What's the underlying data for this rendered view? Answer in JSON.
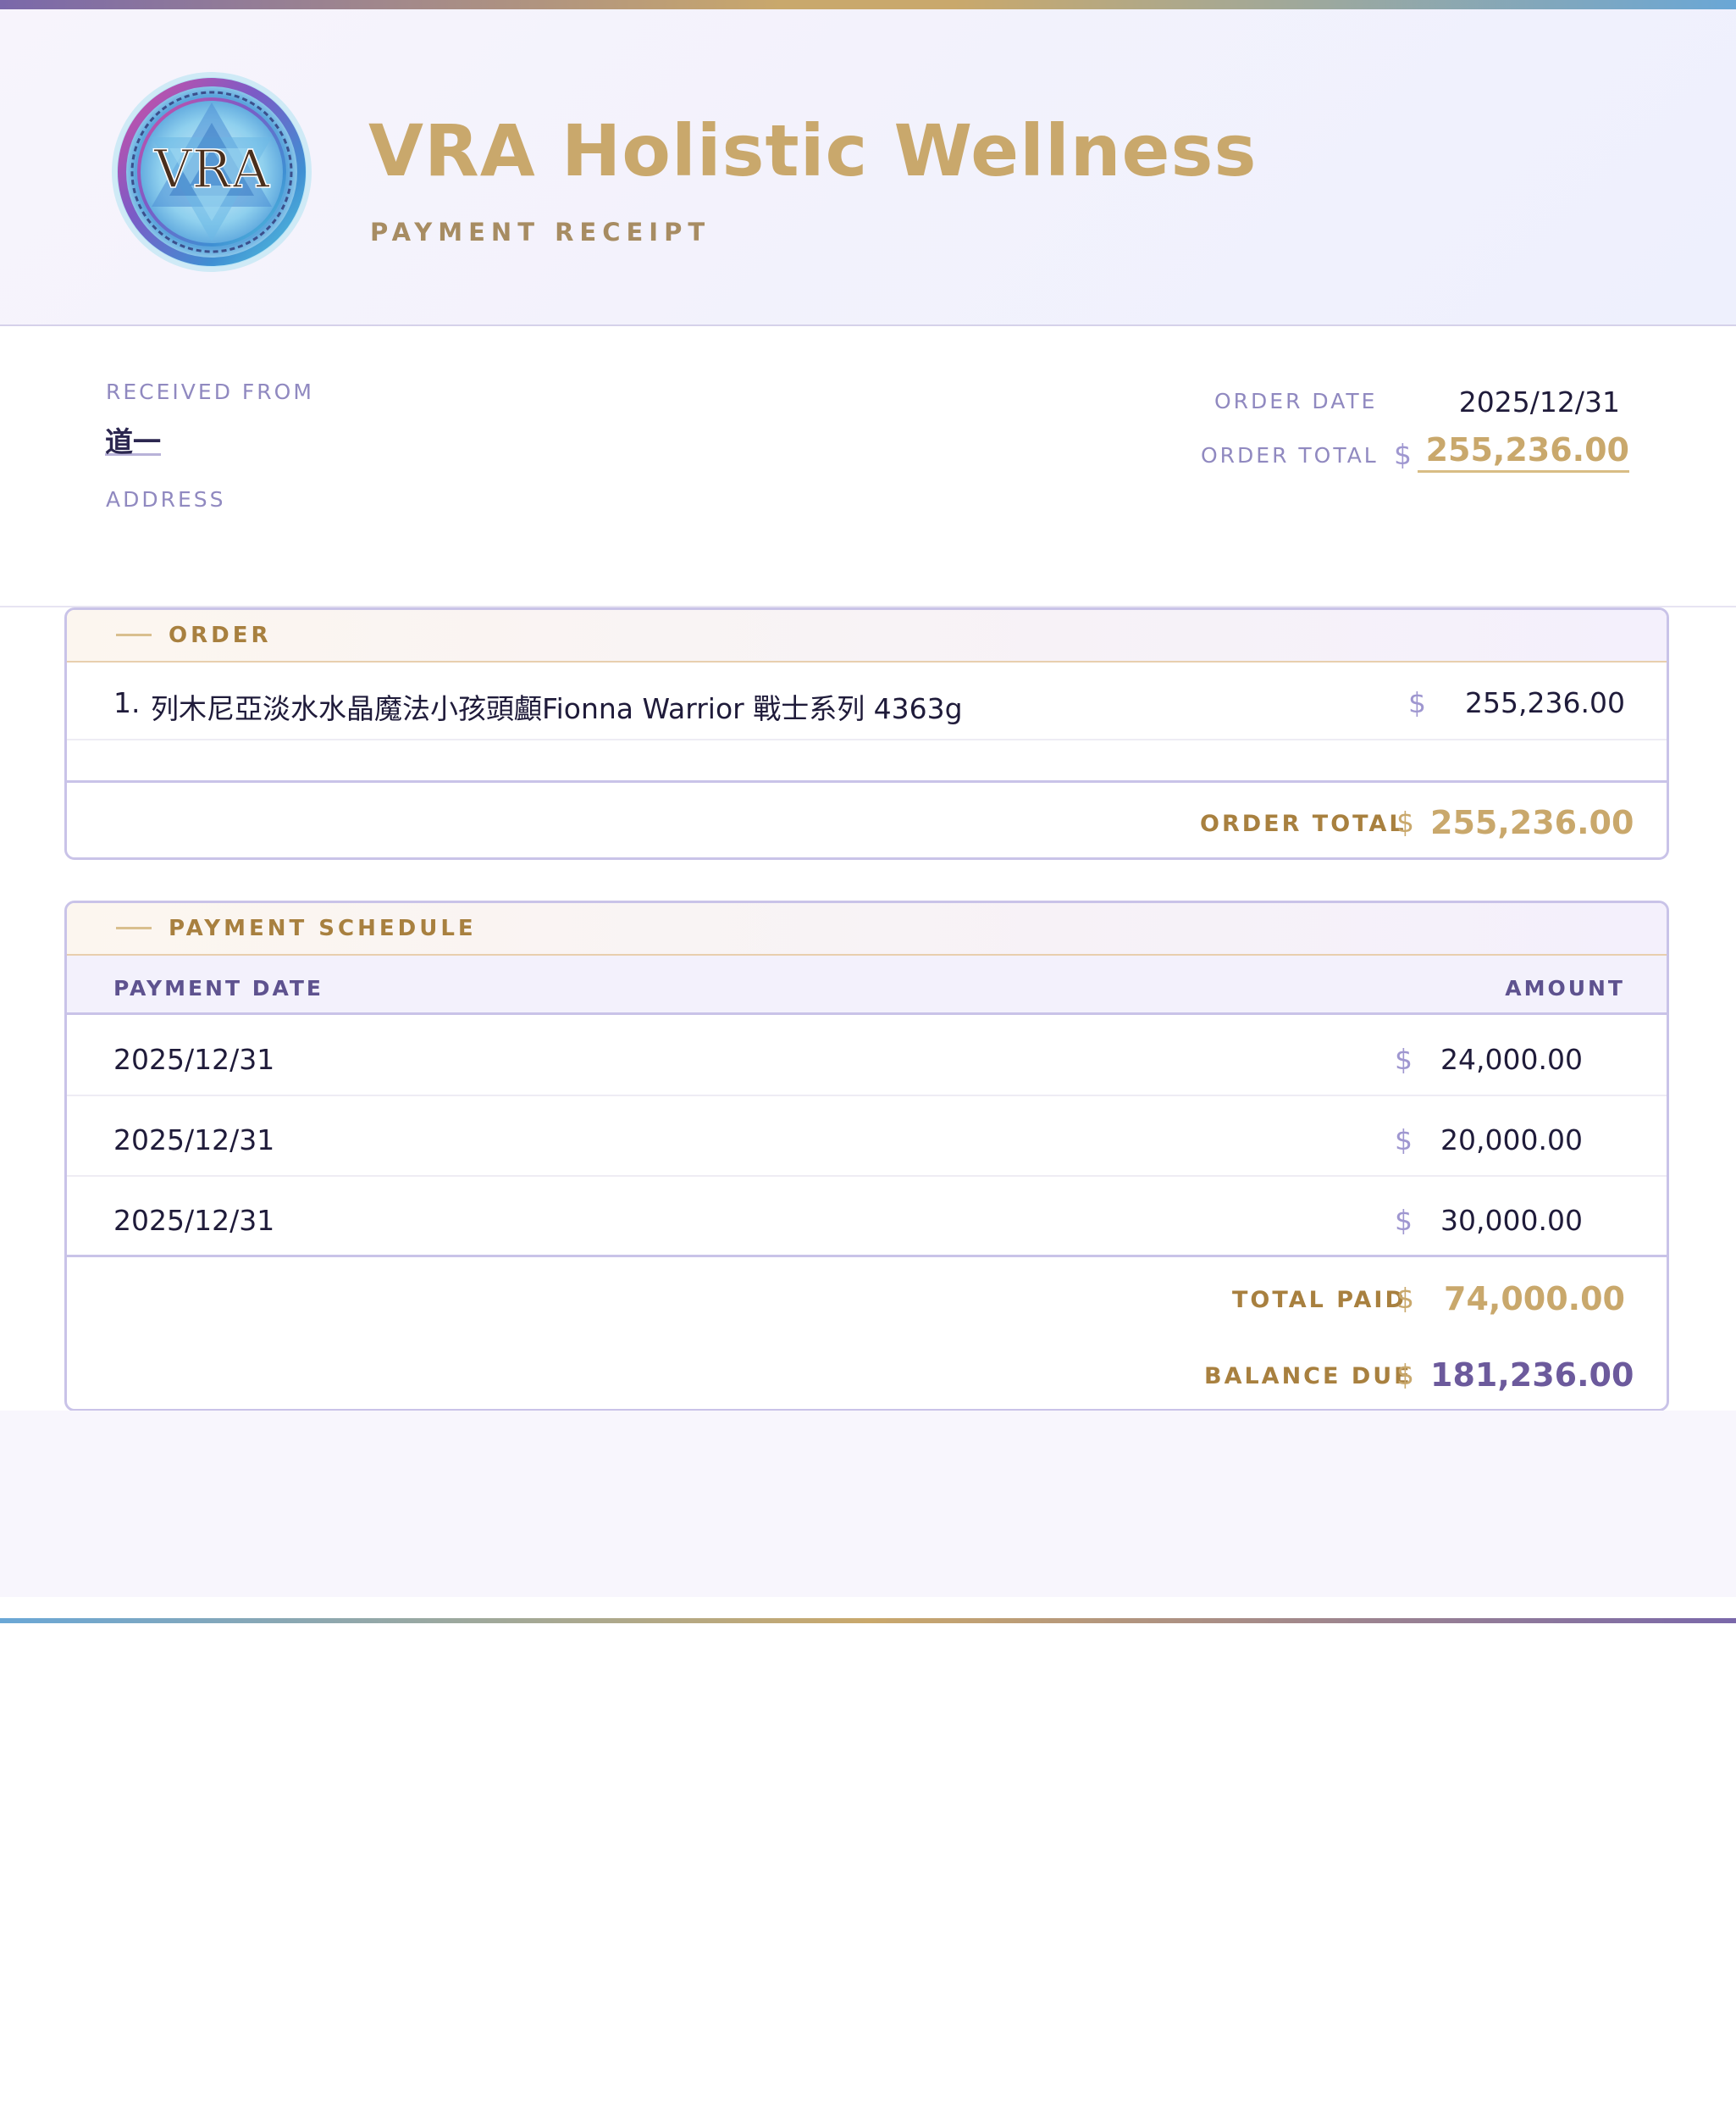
{
  "header": {
    "logo_text": "VRA",
    "brand": "VRA Holistic Wellness",
    "subtitle": "PAYMENT RECEIPT"
  },
  "info": {
    "received_from_label": "RECEIVED FROM",
    "received_from": "道一",
    "address_label": "ADDRESS",
    "order_date_label": "ORDER DATE",
    "order_date": "2025/12/31",
    "order_total_label": "ORDER TOTAL",
    "currency": "$",
    "order_total": "255,236.00"
  },
  "order": {
    "title": "ORDER",
    "items": [
      {
        "index": "1.",
        "description": "列木尼亞淡水水晶魔法小孩頭顱Fionna Warrior 戰士系列 4363g",
        "amount": "255,236.00"
      }
    ],
    "total_label": "ORDER TOTAL",
    "total": "255,236.00"
  },
  "schedule": {
    "title": "PAYMENT SCHEDULE",
    "date_header": "PAYMENT DATE",
    "amount_header": "AMOUNT",
    "payments": [
      {
        "date": "2025/12/31",
        "amount": "24,000.00"
      },
      {
        "date": "2025/12/31",
        "amount": "20,000.00"
      },
      {
        "date": "2025/12/31",
        "amount": "30,000.00"
      }
    ],
    "total_paid_label": "TOTAL PAID",
    "total_paid": "74,000.00",
    "balance_due_label": "BALANCE DUE",
    "balance_due": "181,236.00"
  },
  "colors": {
    "gold": "#c9a86c",
    "lavender": "#9089c0",
    "purple": "#6c5a9c",
    "border": "#c9c3e8"
  }
}
